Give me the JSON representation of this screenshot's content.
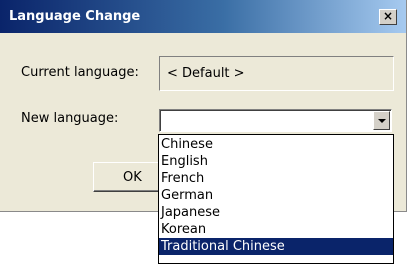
{
  "window": {
    "title": "Language Change",
    "close_label": "×"
  },
  "form": {
    "current_language_label": "Current language:",
    "current_language_value": "< Default >",
    "new_language_label": "New language:",
    "new_language_value": ""
  },
  "buttons": {
    "ok_label": "OK"
  },
  "dropdown": {
    "options": [
      "Chinese",
      "English",
      "French",
      "German",
      "Japanese",
      "Korean",
      "Traditional Chinese"
    ],
    "highlighted": "Traditional Chinese"
  },
  "colors": {
    "title_bar": "#0a246a",
    "dialog_face": "#ece9d8",
    "selection": "#0a246a"
  }
}
